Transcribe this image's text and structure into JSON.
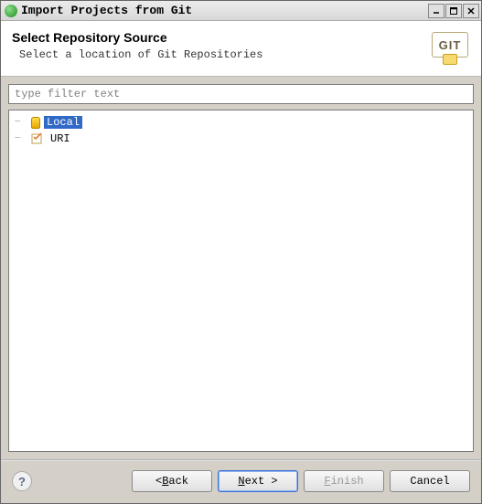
{
  "window": {
    "title": "Import Projects from Git"
  },
  "header": {
    "title": "Select Repository Source",
    "subtitle": "Select a location of Git Repositories",
    "logo_text": "GIT"
  },
  "filter": {
    "placeholder": "type filter text"
  },
  "tree": {
    "items": [
      {
        "label": "Local",
        "icon": "db",
        "selected": true
      },
      {
        "label": "URI",
        "icon": "uri",
        "selected": false
      }
    ]
  },
  "buttons": {
    "back_prefix": "< ",
    "back_mn": "B",
    "back_suffix": "ack",
    "next_mn": "N",
    "next_suffix": "ext >",
    "finish_mn": "F",
    "finish_suffix": "inish",
    "cancel": "Cancel",
    "help": "?"
  }
}
